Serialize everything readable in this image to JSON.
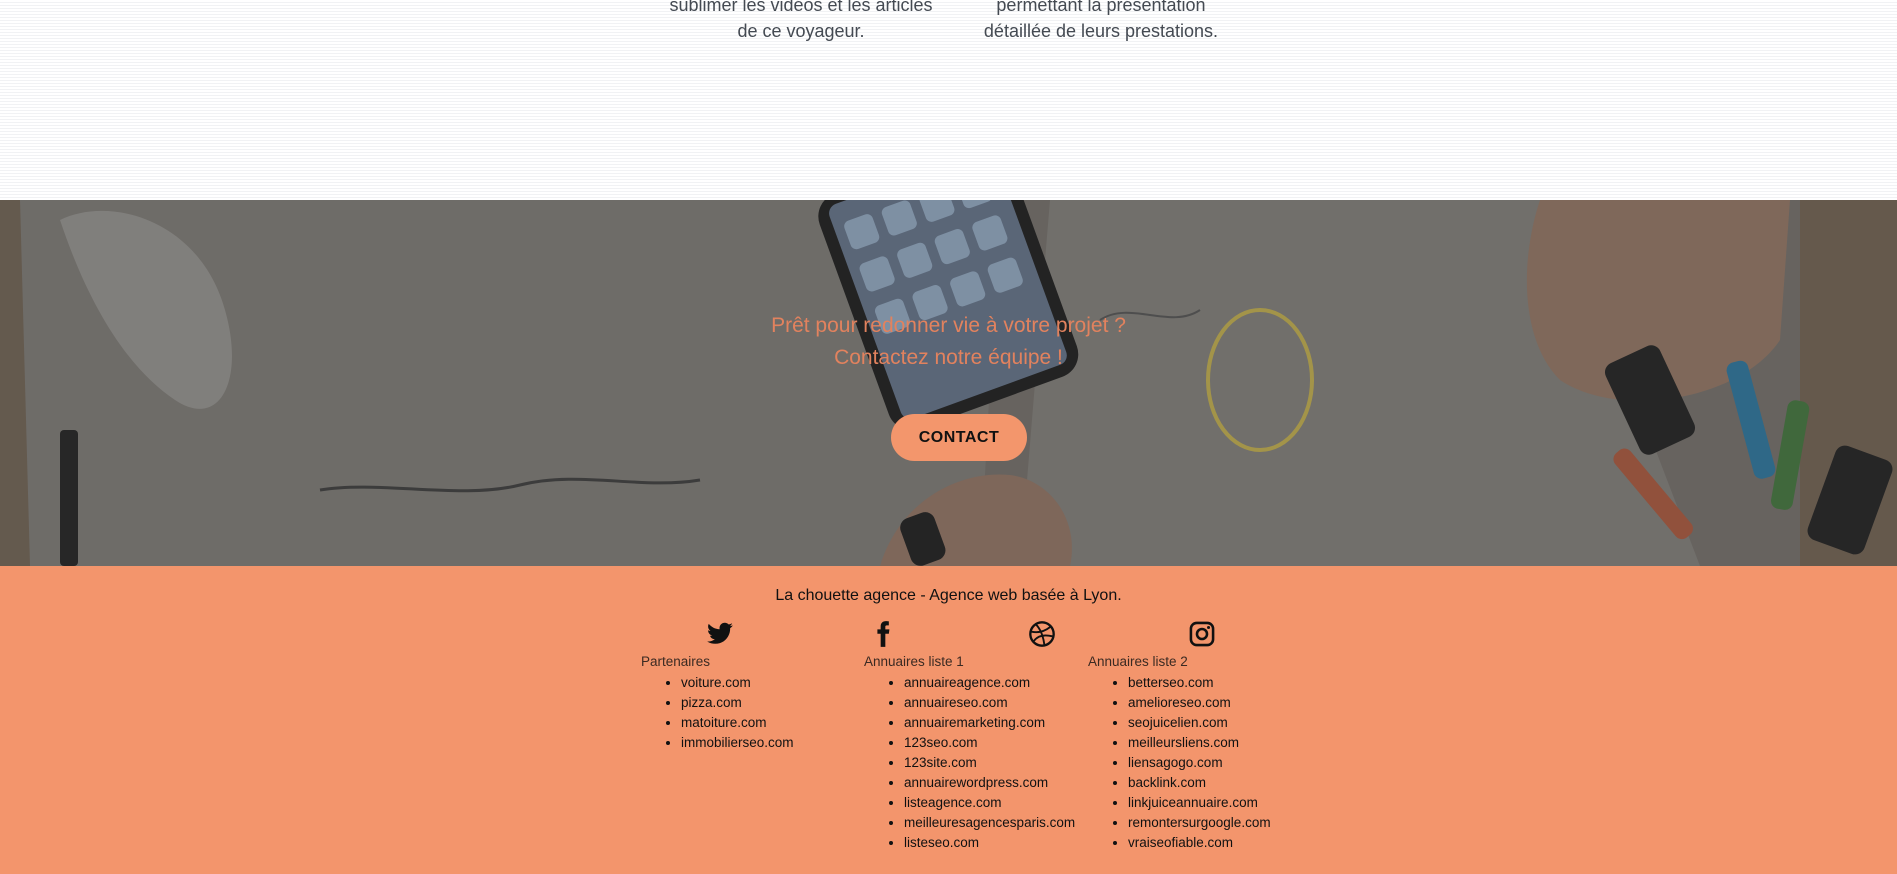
{
  "services": [
    {
      "lines": [
        "sublimer les vidéos et les articles",
        "de ce voyageur."
      ]
    },
    {
      "lines": [
        "permettant la présentation",
        "détaillée de leurs prestations."
      ]
    }
  ],
  "cta": {
    "title_line1": "Prêt pour redonner vie à votre projet ?",
    "title_line2": "Contactez notre équipe !",
    "button_label": "CONTACT"
  },
  "footer": {
    "tagline": "La chouette agence - Agence web basée à Lyon.",
    "social_icons": [
      "twitter-icon",
      "facebook-icon",
      "dribbble-icon",
      "instagram-icon"
    ],
    "columns": [
      {
        "heading": "Partenaires",
        "items": [
          "voiture.com",
          "pizza.com",
          "matoiture.com",
          "immobilierseo.com"
        ]
      },
      {
        "heading": "Annuaires liste 1",
        "items": [
          "annuaireagence.com",
          "annuaireseo.com",
          "annuairemarketing.com",
          "123seo.com",
          "123site.com",
          "annuairewordpress.com",
          "listeagence.com",
          "meilleuresagencesparis.com",
          "listeseo.com"
        ]
      },
      {
        "heading": "Annuaires liste 2",
        "items": [
          "betterseo.com",
          "amelioreseo.com",
          "seojuicelien.com",
          "meilleursliens.com",
          "liensagogo.com",
          "backlink.com",
          "linkjuiceannuaire.com",
          "remontersurgoogle.com",
          "vraiseofiable.com"
        ]
      }
    ]
  },
  "colors": {
    "accent": "#f3956c",
    "cta_title": "#e2825e",
    "overlay": "#6d6b69"
  }
}
